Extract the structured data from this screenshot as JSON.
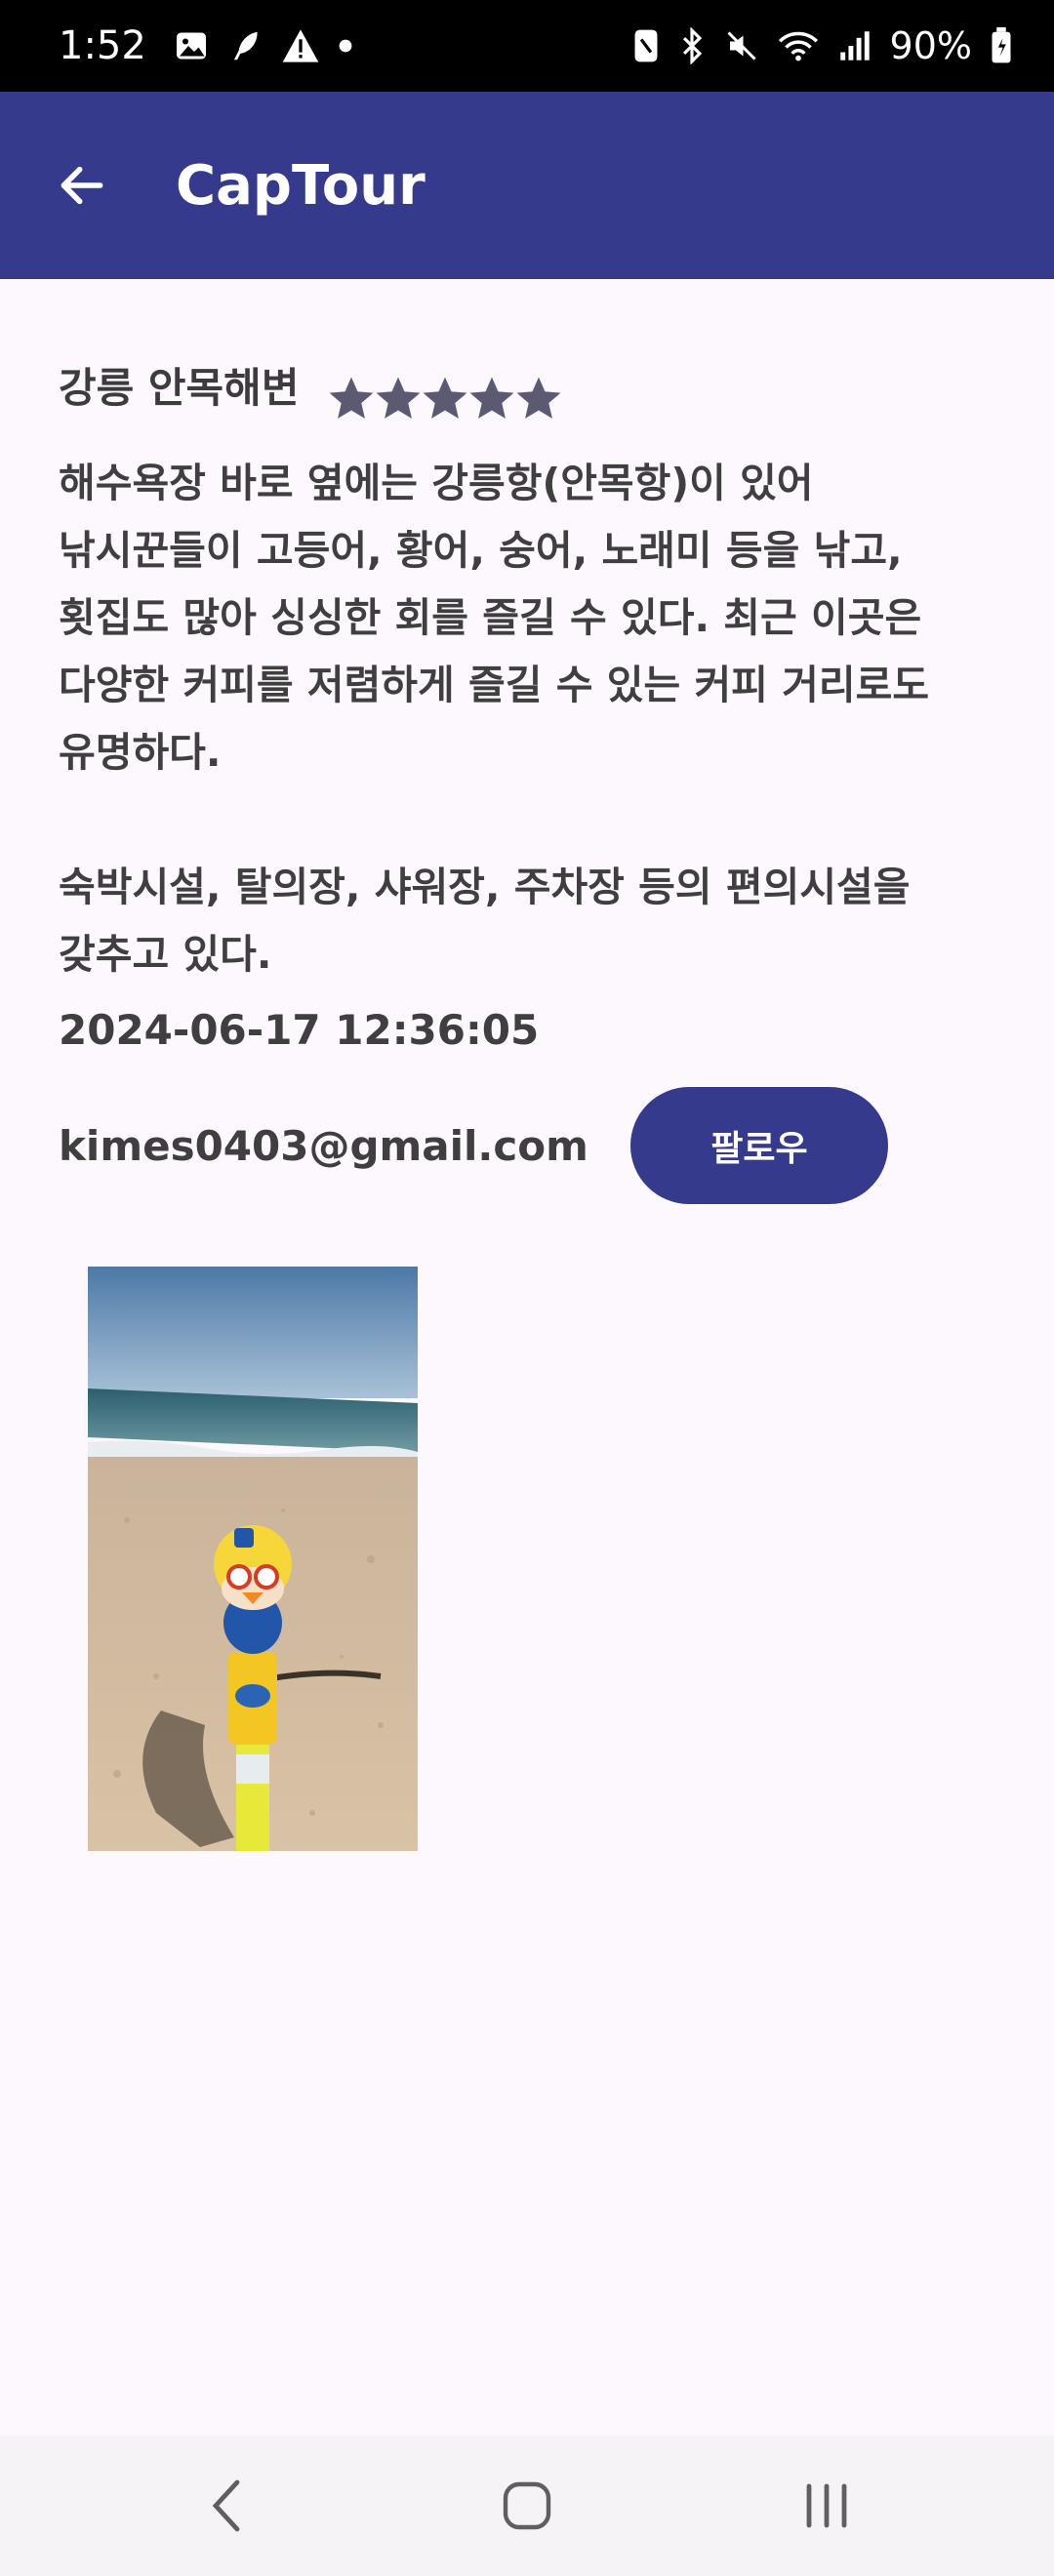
{
  "status_bar": {
    "time": "1:52",
    "battery": "90%",
    "left_icons": [
      "gallery-icon",
      "feather-icon",
      "warning-icon",
      "dot-icon"
    ],
    "right_icons": [
      "nfc-icon",
      "bluetooth-icon",
      "mute-icon",
      "wifi-icon",
      "signal-icon",
      "battery-icon"
    ]
  },
  "app_bar": {
    "title": "CapTour",
    "back_icon": "arrow-left-icon",
    "background": "#353a8c"
  },
  "post": {
    "place_name": "강릉 안목해변",
    "rating": 5,
    "rating_max": 5,
    "description": "해수욕장 바로 옆에는 강릉항(안목항)이 있어\n낚시꾼들이 고등어, 황어, 숭어, 노래미 등을 낚고,\n횟집도 많아 싱싱한 회를 즐길 수 있다. 최근 이곳은\n다양한 커피를 저렴하게 즐길 수 있는 커피 거리로도\n유명하다.\n\n숙박시설, 탈의장, 샤워장, 주차장 등의 편의시설을\n갖추고 있다.",
    "timestamp": "2024-06-17 12:36:05",
    "author_email": "kimes0403@gmail.com",
    "follow_label": "팔로우"
  },
  "nav_bar": {
    "back": "nav-back-icon",
    "home": "nav-home-icon",
    "recents": "nav-recents-icon"
  },
  "colors": {
    "primary": "#353a8c",
    "background": "#fdf8fd",
    "star": "#5b5a72"
  }
}
